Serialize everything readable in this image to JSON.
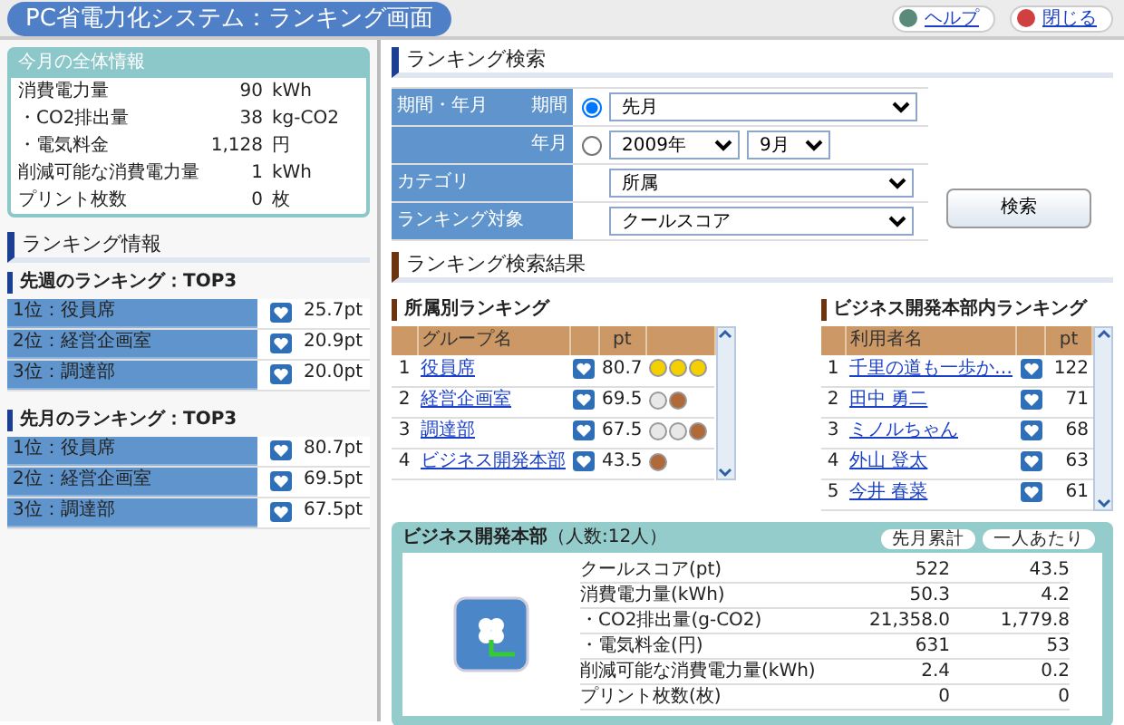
{
  "header": {
    "title": "PC省電力化システム：ランキング画面",
    "links": [
      {
        "kind": "help",
        "label": "ヘルプ"
      },
      {
        "kind": "close",
        "label": "閉じる"
      }
    ]
  },
  "summary": {
    "title": "今月の全体情報",
    "rows": [
      {
        "label": "消費電力量",
        "value": "90",
        "unit": "kWh"
      },
      {
        "label": "・CO2排出量",
        "value": "38",
        "unit": "kg-CO2"
      },
      {
        "label": "・電気料金",
        "value": "1,128",
        "unit": "円"
      },
      {
        "label": "削減可能な消費電力量",
        "value": "1",
        "unit": "kWh"
      },
      {
        "label": "プリント枚数",
        "value": "0",
        "unit": "枚"
      }
    ]
  },
  "ranking_info": {
    "title": "ランキング情報",
    "sections": [
      {
        "title": "先週のランキング：TOP3",
        "items": [
          {
            "label": "1位：役員席",
            "points": "25.7pt"
          },
          {
            "label": "2位：経営企画室",
            "points": "20.9pt"
          },
          {
            "label": "3位：調達部",
            "points": "20.0pt"
          }
        ]
      },
      {
        "title": "先月のランキング：TOP3",
        "items": [
          {
            "label": "1位：役員席",
            "points": "80.7pt"
          },
          {
            "label": "2位：経営企画室",
            "points": "69.5pt"
          },
          {
            "label": "3位：調達部",
            "points": "67.5pt"
          }
        ]
      }
    ]
  },
  "search": {
    "title": "ランキング検索",
    "period_group_label": "期間・年月",
    "period": {
      "label": "期間",
      "selected": true,
      "value": "先月"
    },
    "year_month": {
      "label": "年月",
      "selected": false,
      "year": "2009年",
      "month": "9月"
    },
    "category": {
      "label": "カテゴリ",
      "value": "所属"
    },
    "target": {
      "label": "ランキング対象",
      "value": "クールスコア"
    },
    "button": "検索"
  },
  "results": {
    "title": "ランキング検索結果",
    "group_ranking": {
      "title": "所属別ランキング",
      "columns": [
        "グループ名",
        "pt"
      ],
      "rows": [
        {
          "rank": "1",
          "name": "役員席",
          "points": "80.7",
          "medals": [
            {
              "color": "#f5d000"
            },
            {
              "color": "#f5d000"
            },
            {
              "color": "#f5d000"
            }
          ]
        },
        {
          "rank": "2",
          "name": "経営企画室",
          "points": "69.5",
          "medals": [
            {
              "color": "#e8e8e8"
            },
            {
              "color": "#b06a3a"
            }
          ]
        },
        {
          "rank": "3",
          "name": "調達部",
          "points": "67.5",
          "medals": [
            {
              "color": "#e8e8e8"
            },
            {
              "color": "#e8e8e8"
            },
            {
              "color": "#b06a3a"
            }
          ]
        },
        {
          "rank": "4",
          "name": "ビジネス開発本部",
          "points": "43.5",
          "medals": [
            {
              "color": "#b06a3a"
            }
          ]
        }
      ]
    },
    "user_ranking": {
      "title": "ビジネス開発本部内ランキング",
      "columns": [
        "利用者名",
        "pt"
      ],
      "rows": [
        {
          "rank": "1",
          "name": "千里の道も一歩か…",
          "points": "122"
        },
        {
          "rank": "2",
          "name": "田中 勇二",
          "points": "71"
        },
        {
          "rank": "3",
          "name": "ミノルちゃん",
          "points": "68"
        },
        {
          "rank": "4",
          "name": "外山 登太",
          "points": "63"
        },
        {
          "rank": "5",
          "name": "今井 春菜",
          "points": "61"
        }
      ]
    }
  },
  "detail": {
    "title": "ビジネス開発本部",
    "subtitle": "（人数:12人）",
    "columns": [
      "先月累計",
      "一人あたり"
    ],
    "rows": [
      {
        "label": "クールスコア(pt)",
        "total": "522",
        "per_person": "43.5"
      },
      {
        "label": "消費電力量(kWh)",
        "total": "50.3",
        "per_person": "4.2"
      },
      {
        "label": "・CO2排出量(g-CO2)",
        "total": "21,358.0",
        "per_person": "1,779.8"
      },
      {
        "label": "・電気料金(円)",
        "total": "631",
        "per_person": "53"
      },
      {
        "label": "削減可能な消費電力量(kWh)",
        "total": "2.4",
        "per_person": "0.2"
      },
      {
        "label": "プリント枚数(枚)",
        "total": "0",
        "per_person": "0"
      }
    ]
  }
}
